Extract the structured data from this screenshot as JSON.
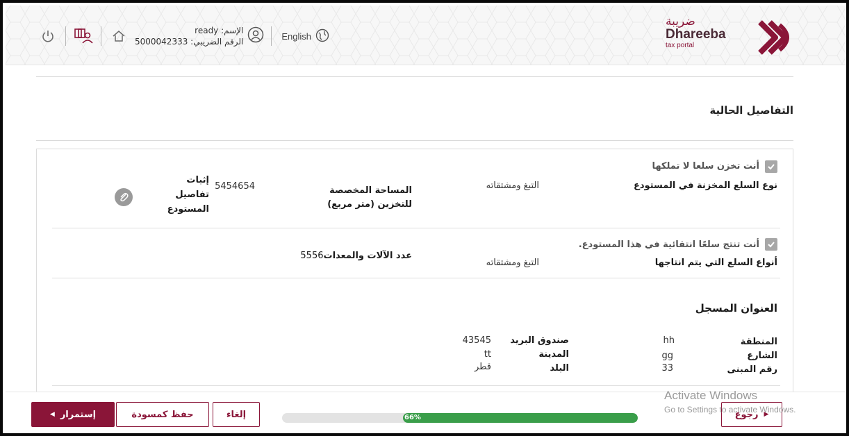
{
  "header": {
    "brand_ar": "ضريبة",
    "brand_en": "Dhareeba",
    "brand_sub": "tax portal",
    "language": "English",
    "user_name_label": "الإسم: ready",
    "tax_number_label": "الرقم الضريبي: 5000042333",
    "icons": [
      "logout-icon",
      "profile-switch-icon",
      "home-icon",
      "user-icon",
      "globe-icon"
    ]
  },
  "current_details": {
    "title": "التفاصيل الحالية"
  },
  "storage": {
    "checkbox_label": "أنت تخزن سلعا لا تملكها",
    "goods_type_label": "نوع السلع المخزنة في المستودع",
    "goods_type_value": "التبغ ومشتقاته",
    "area_label": "المساحة المخصصة للتخزين (متر مربع)",
    "area_value": "5454654",
    "proof_label": "إثبات تفاصيل المستودع"
  },
  "production": {
    "checkbox_label": "أنت تنتج سلعًا انتقائية في هذا المستودع.",
    "goods_type_label": "أنواع السلع التي يتم انتاجها",
    "goods_type_value": "التبغ ومشتقاته",
    "machines_label": "عدد الآلات والمعدات",
    "machines_value": "5556"
  },
  "address": {
    "title": "العنوان المسجل",
    "rows": [
      {
        "label_r": "المنطقة",
        "value_r": "hh",
        "label_l": "صندوق البريد",
        "value_l": "43545"
      },
      {
        "label_r": "الشارع",
        "value_r": "gg",
        "label_l": "المدينة",
        "value_l": "tt"
      },
      {
        "label_r": "رقم المبنى",
        "value_r": "33",
        "label_l": "البلد",
        "value_l": "قطر"
      }
    ]
  },
  "footer": {
    "continue_label": "إستمرار",
    "save_draft_label": "حفظ كمسودة",
    "cancel_label": "إلغاء",
    "back_label": "رجوع",
    "progress_text": "66%",
    "progress_fraction": 0.66
  },
  "watermark": {
    "line1": "Activate Windows",
    "line2": "Go to Settings to activate Windows."
  },
  "colors": {
    "brand": "#8a1538",
    "progress": "#3a9e4a",
    "checkbox": "#a7a7a7"
  }
}
